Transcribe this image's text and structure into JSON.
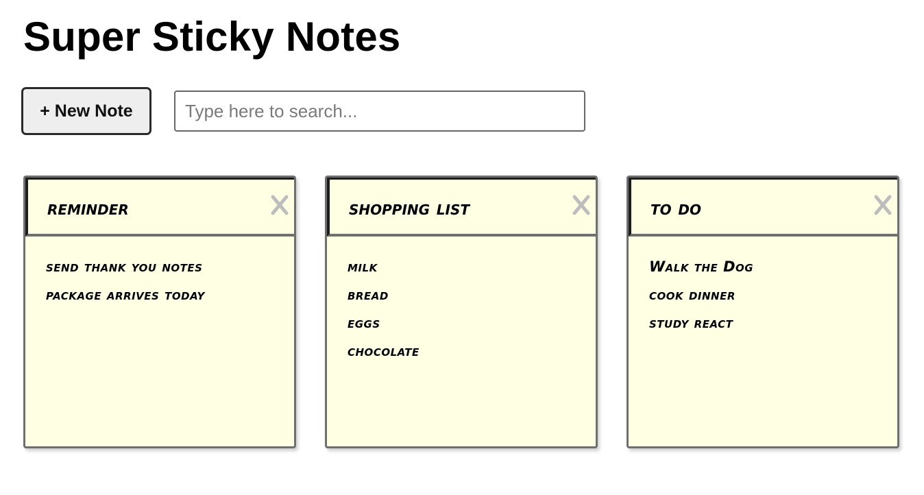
{
  "app": {
    "title": "Super Sticky Notes"
  },
  "toolbar": {
    "new_note_label": "+ New Note"
  },
  "search": {
    "placeholder": "Type here to search...",
    "value": ""
  },
  "notes": [
    {
      "title": "reminder",
      "lines": [
        "send thank you notes",
        "package arrives today"
      ],
      "close_icon": "close-x-icon"
    },
    {
      "title": "Shopping list",
      "lines": [
        "milk",
        "bread",
        "eggs",
        "chocolate"
      ],
      "close_icon": "close-x-icon"
    },
    {
      "title": "To Do",
      "lines": [
        "Walk the Dog",
        "cook dinner",
        "study react"
      ],
      "close_icon": "close-x-icon"
    }
  ],
  "colors": {
    "note_background": "#ffffe3",
    "note_border": "#6f6f6f",
    "close_icon": "#bdbdbd",
    "button_background": "#eeeeee"
  }
}
